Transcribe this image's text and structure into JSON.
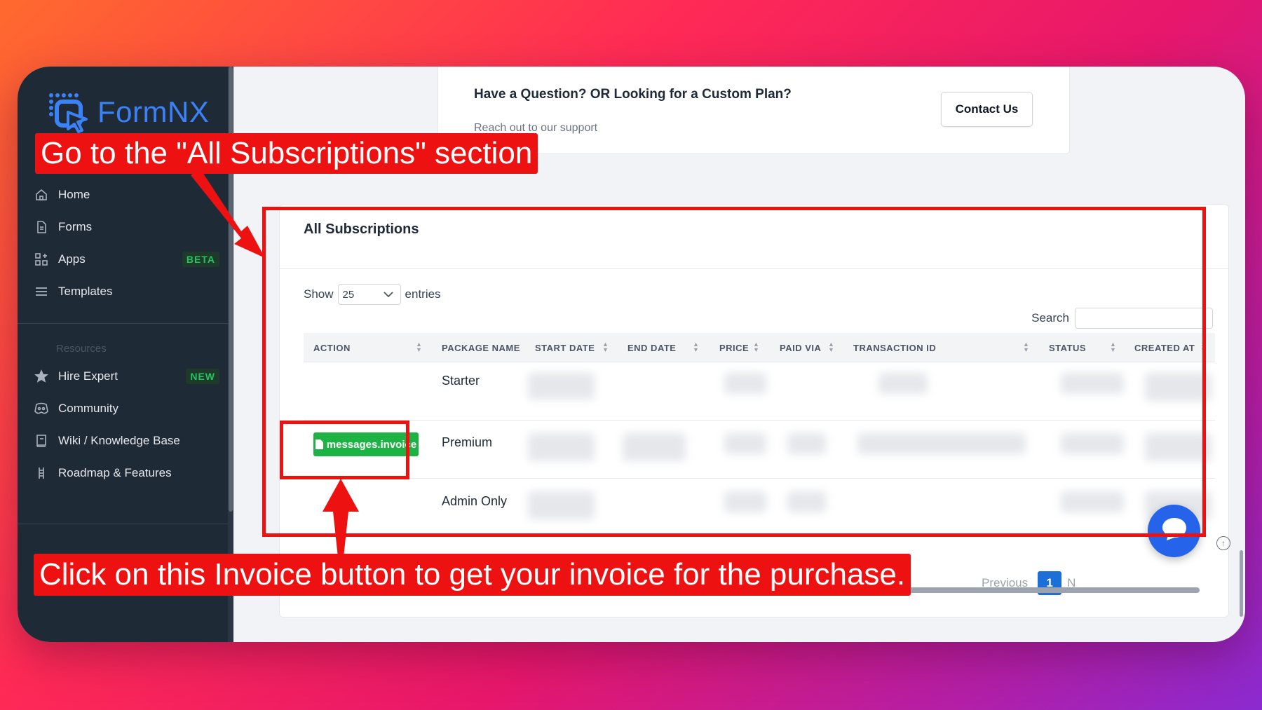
{
  "sidebar": {
    "logo_text": "FormNX",
    "items": [
      {
        "label": "Home",
        "icon": "home-icon"
      },
      {
        "label": "Forms",
        "icon": "document-icon"
      },
      {
        "label": "Apps",
        "icon": "apps-grid-icon",
        "badge": "BETA"
      },
      {
        "label": "Templates",
        "icon": "list-icon"
      }
    ],
    "resources_label": "Resources",
    "resources": [
      {
        "label": "Hire Expert",
        "icon": "star-icon",
        "badge": "NEW"
      },
      {
        "label": "Community",
        "icon": "discord-icon"
      },
      {
        "label": "Wiki / Knowledge Base",
        "icon": "book-icon"
      },
      {
        "label": "Roadmap & Features",
        "icon": "roadmap-icon"
      }
    ]
  },
  "question_card": {
    "title": "Have a Question? OR Looking for a Custom Plan?",
    "subtitle": "Reach out to our support",
    "contact_button": "Contact Us"
  },
  "subscriptions": {
    "title": "All Subscriptions",
    "show_label": "Show",
    "entries_value": "25",
    "entries_label": "entries",
    "search_label": "Search",
    "search_placeholder": "",
    "columns": [
      "ACTION",
      "PACKAGE NAME",
      "START DATE",
      "END DATE",
      "PRICE",
      "PAID VIA",
      "TRANSACTION ID",
      "STATUS",
      "CREATED AT"
    ],
    "rows": [
      {
        "package": "Starter",
        "action": ""
      },
      {
        "package": "Premium",
        "action": "messages.invoice"
      },
      {
        "package": "Admin Only",
        "action": ""
      }
    ],
    "pager_previous": "Previous",
    "pager_current": "1",
    "pager_next": "N"
  },
  "annotations": {
    "top_callout": "Go to the \"All Subscriptions\" section",
    "bottom_callout": "Click on this Invoice button to get your invoice for the purchase."
  },
  "colors": {
    "accent": "#ee1111",
    "sidebar_bg": "#1f2a37",
    "invoice_green": "#1db344",
    "primary_blue": "#1d6fd8"
  }
}
